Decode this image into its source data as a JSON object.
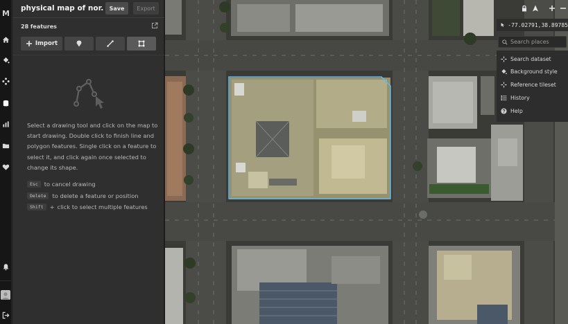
{
  "app": {
    "logo": "M"
  },
  "header": {
    "title": "physical map of nor...",
    "save_label": "Save",
    "export_label": "Export"
  },
  "features": {
    "count_label": "28 features"
  },
  "toolbar": {
    "import_label": "Import"
  },
  "help": {
    "intro": "Select a drawing tool and click on the map to start drawing. Double click to finish line and polygon features. Single click on a feature to select it, and click again once selected to change its shape.",
    "shortcuts": [
      {
        "key": "Esc",
        "text": "to cancel drawing"
      },
      {
        "key": "Delete",
        "text": "to delete a feature or position"
      },
      {
        "key": "Shift",
        "text": "click to select multiple features"
      }
    ],
    "shift_plus": "+"
  },
  "map_controls": {
    "coordinates": "-77.02791,38.89785",
    "search_placeholder": "Search places",
    "menu": [
      {
        "label": "Search dataset",
        "icon": "search-dataset-icon"
      },
      {
        "label": "Background style",
        "icon": "paint-bucket-icon"
      },
      {
        "label": "Reference tileset",
        "icon": "tileset-icon"
      },
      {
        "label": "History",
        "icon": "history-icon"
      },
      {
        "label": "Help",
        "icon": "help-icon"
      }
    ]
  },
  "colors": {
    "selection_outline": "#5fb8e6",
    "panel_bg": "#2f2f2f",
    "rail_bg": "#161616"
  }
}
